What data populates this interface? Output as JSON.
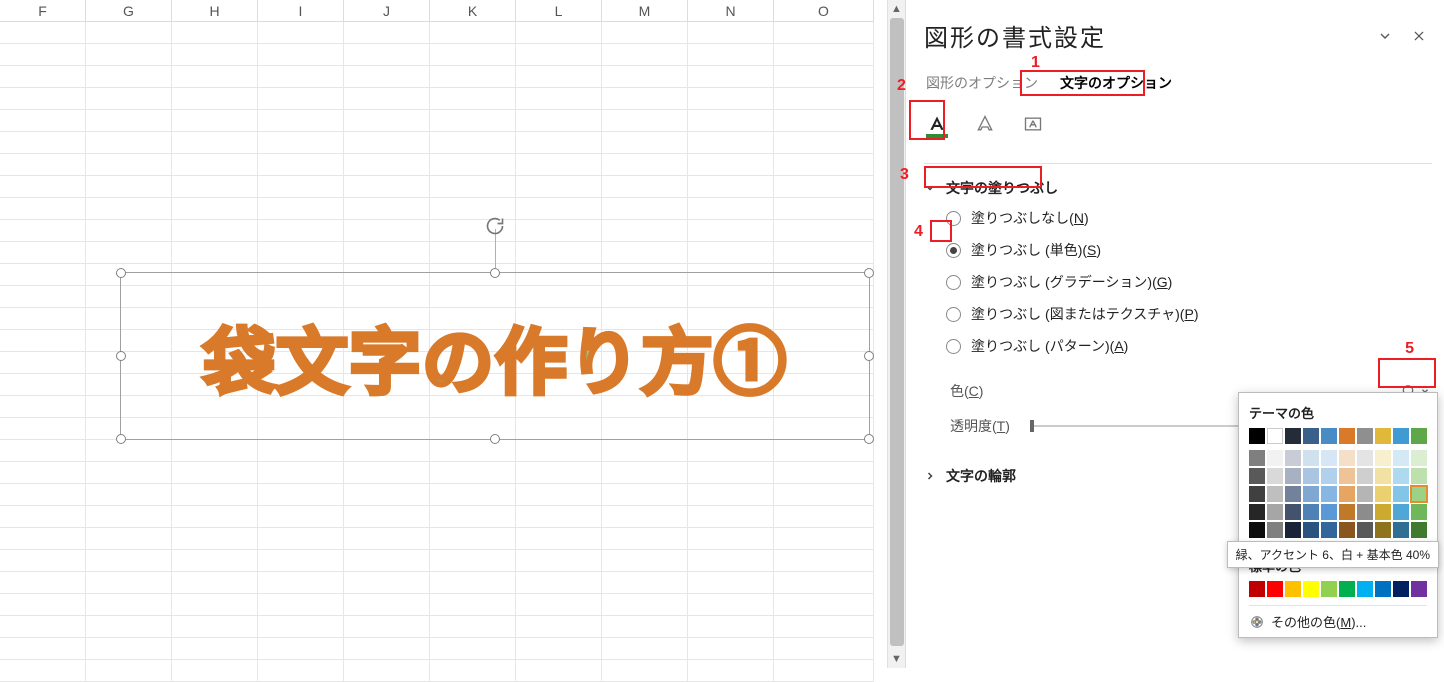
{
  "columns": [
    "F",
    "G",
    "H",
    "I",
    "J",
    "K",
    "L",
    "M",
    "N",
    "O"
  ],
  "shape_text": "袋文字の作り方①",
  "pane": {
    "title": "図形の書式設定",
    "tab_shape": "図形のオプション",
    "tab_text": "文字のオプション",
    "section_fill": "文字の塗りつぶし",
    "opt_none": "塗りつぶしなし",
    "opt_none_m": "N",
    "opt_solid": "塗りつぶし (単色)",
    "opt_solid_m": "S",
    "opt_grad": "塗りつぶし (グラデーション)",
    "opt_grad_m": "G",
    "opt_pic": "塗りつぶし (図またはテクスチャ)",
    "opt_pic_m": "P",
    "opt_pat": "塗りつぶし (パターン)",
    "opt_pat_m": "A",
    "color_label": "色",
    "color_m": "C",
    "trans_label": "透明度",
    "trans_m": "T",
    "section_outline": "文字の輪郭"
  },
  "picker": {
    "theme_hdr": "テーマの色",
    "std_hdr": "標準の色",
    "more": "その他の色",
    "more_m": "M",
    "tooltip": "緑、アクセント 6、白 + 基本色 40%",
    "theme_row0": [
      "#000000",
      "#ffffff",
      "#242c3a",
      "#3a5f8b",
      "#4a8bc6",
      "#d87a2a",
      "#8f8f8f",
      "#e0b93a",
      "#3f9bd1",
      "#5fa84a"
    ],
    "theme_shades": [
      [
        "#7f7f7f",
        "#f2f2f2",
        "#c7ccd6",
        "#cfe0ef",
        "#d6e6f5",
        "#f6dfc8",
        "#e4e4e4",
        "#f8efcf",
        "#d3eaf6",
        "#dbeed2"
      ],
      [
        "#595959",
        "#d9d9d9",
        "#a7b1c2",
        "#a9c5e2",
        "#b1d0ec",
        "#eec398",
        "#cfcfcf",
        "#f1e1a3",
        "#aed9ef",
        "#bde0ad"
      ],
      [
        "#404040",
        "#bfbfbf",
        "#72829b",
        "#7ea7d2",
        "#86b7e2",
        "#e6a563",
        "#b5b5b5",
        "#ead071",
        "#82c5e6",
        "#9bd286"
      ],
      [
        "#262626",
        "#a6a6a6",
        "#43536e",
        "#4e82b6",
        "#5a99d5",
        "#c07829",
        "#8c8c8c",
        "#cbaa2f",
        "#4fa7d8",
        "#6fb75b"
      ],
      [
        "#0d0d0d",
        "#808080",
        "#1a2438",
        "#2b537f",
        "#33669a",
        "#8a561e",
        "#595959",
        "#8f741e",
        "#2f6f94",
        "#3f7a2f"
      ]
    ],
    "standard": [
      "#c00000",
      "#ff0000",
      "#ffc000",
      "#ffff00",
      "#92d050",
      "#00b050",
      "#00b0f0",
      "#0070c0",
      "#002060",
      "#7030a0"
    ]
  },
  "annotations": {
    "n1": "1",
    "n2": "2",
    "n3": "3",
    "n4": "4",
    "n5": "5"
  }
}
